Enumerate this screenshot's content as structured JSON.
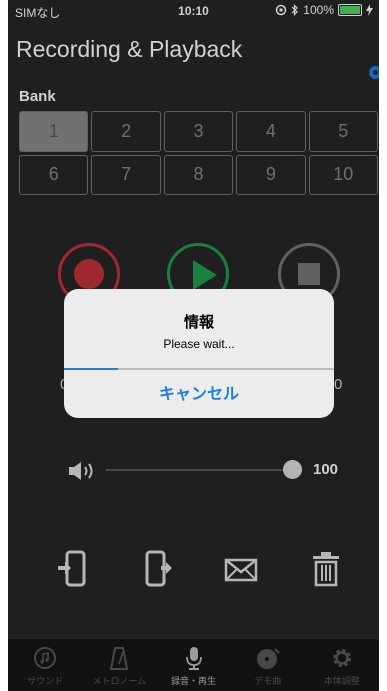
{
  "status": {
    "carrier": "SIMなし",
    "time": "10:10",
    "battery": "100%"
  },
  "title": "Recording & Playback",
  "bank": {
    "label": "Bank",
    "cells": [
      "1",
      "2",
      "3",
      "4",
      "5",
      "6",
      "7",
      "8",
      "9",
      "10"
    ],
    "selected": "1"
  },
  "position": {
    "left": "0",
    "right": "0"
  },
  "volume": {
    "value": "100",
    "level": 1.0
  },
  "tabs": [
    {
      "label": "サウンド",
      "icon": "sound-icon"
    },
    {
      "label": "メトロノーム",
      "icon": "metronome-icon"
    },
    {
      "label": "録音・再生",
      "icon": "microphone-icon",
      "active": true
    },
    {
      "label": "デモ曲",
      "icon": "demo-song-icon"
    },
    {
      "label": "本体調整",
      "icon": "gear-icon"
    }
  ],
  "dialog": {
    "title": "情報",
    "message": "Please wait...",
    "cancel": "キャンセル",
    "progress": 0.2
  },
  "colors": {
    "accent": "#1e7bf0",
    "record": "#c4323c",
    "play": "#1e9e4a",
    "battery": "#4cd964"
  }
}
